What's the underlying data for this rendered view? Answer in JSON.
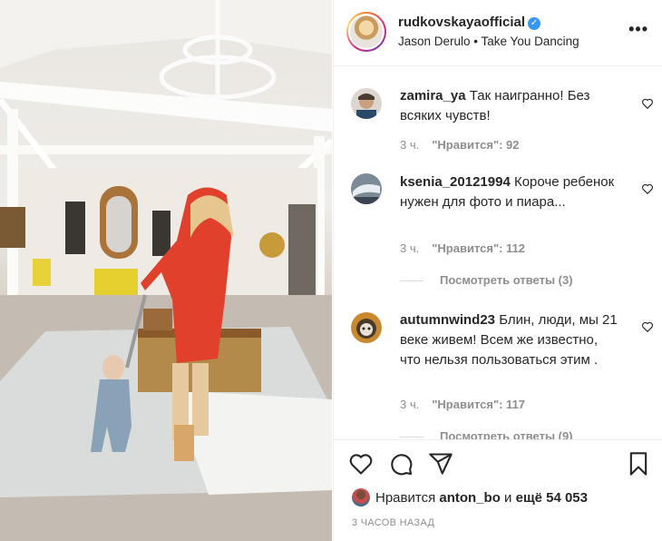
{
  "post_header": {
    "username": "rudkovskayaofficial",
    "verified": true,
    "audio": "Jason Derulo • Take You Dancing",
    "more_icon": "more-dots-icon"
  },
  "comments": [
    {
      "username": "zamira_ya",
      "text": "Так наигранно! Без всяких чувств!",
      "time": "3 ч.",
      "likes": "\"Нравится\": 92"
    },
    {
      "username": "ksenia_20121994",
      "text": "Короче ребенок нужен для фото и пиара...",
      "time": "3 ч.",
      "likes": "\"Нравится\": 112",
      "replies": "Посмотреть ответы (3)"
    },
    {
      "username": "autumnwind23",
      "text": "Блин, люди, мы 21 веке живем! Всем же известно, что нельзя пользоваться этим .",
      "time": "3 ч.",
      "likes": "\"Нравится\": 117",
      "replies": "Посмотреть ответы (9)"
    }
  ],
  "actions": {
    "icons": [
      "heart-icon",
      "comment-icon",
      "share-icon",
      "bookmark-icon"
    ],
    "likes_prefix": "Нравится",
    "likes_user": "anton_bo",
    "likes_connector": "и",
    "likes_rest": "ещё 54 053",
    "posted_ago": "3 ЧАСОВ НАЗАД"
  },
  "colors": {
    "text": "#262626",
    "secondary": "#8e8e8e",
    "verified": "#3897f0",
    "divider": "#efefef"
  }
}
